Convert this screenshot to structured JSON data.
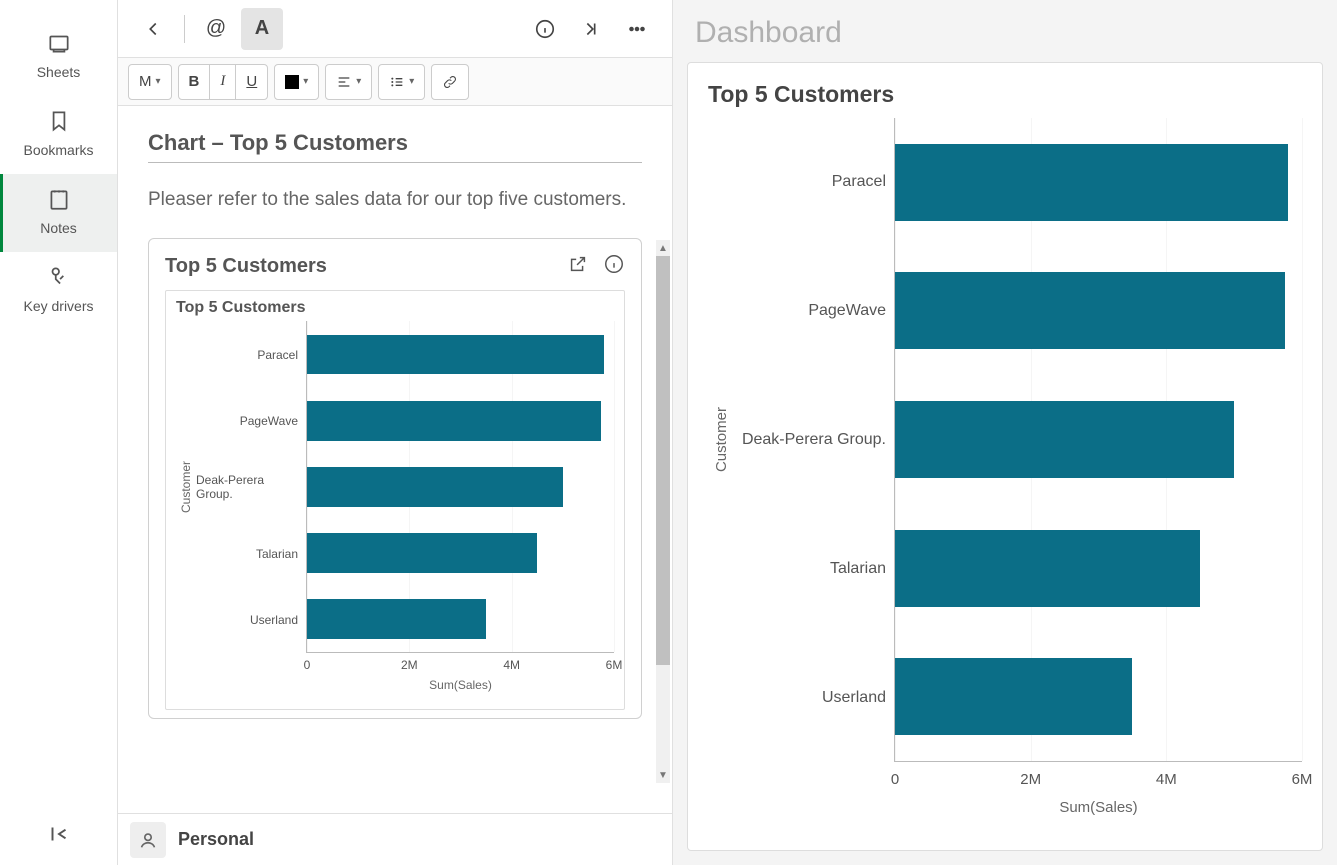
{
  "sidebar": {
    "items": [
      {
        "label": "Sheets"
      },
      {
        "label": "Bookmarks"
      },
      {
        "label": "Notes"
      },
      {
        "label": "Key drivers"
      }
    ]
  },
  "topbar": {
    "mention_glyph": "@",
    "text_tool_glyph": "A"
  },
  "formatbar": {
    "heading_label": "M",
    "bold": "B",
    "italic": "I",
    "underline": "U"
  },
  "note": {
    "title": "Chart – Top 5 Customers",
    "body": "Pleaser refer to the sales data for our top five customers.",
    "card_title": "Top 5 Customers",
    "inner_title": "Top 5 Customers"
  },
  "footer": {
    "label": "Personal"
  },
  "dashboard": {
    "title": "Dashboard",
    "card_title": "Top 5 Customers"
  },
  "chart_data": {
    "type": "bar",
    "orientation": "horizontal",
    "categories": [
      "Paracel",
      "PageWave",
      "Deak-Perera Group.",
      "Talarian",
      "Userland"
    ],
    "values": [
      5800000,
      5750000,
      5000000,
      4500000,
      3500000
    ],
    "ylabel": "Customer",
    "xlabel": "Sum(Sales)",
    "xlim": [
      0,
      6000000
    ],
    "xtick_values": [
      0,
      2000000,
      4000000,
      6000000
    ],
    "xtick_labels": [
      "0",
      "2M",
      "4M",
      "6M"
    ],
    "bar_color": "#0b6e87"
  }
}
